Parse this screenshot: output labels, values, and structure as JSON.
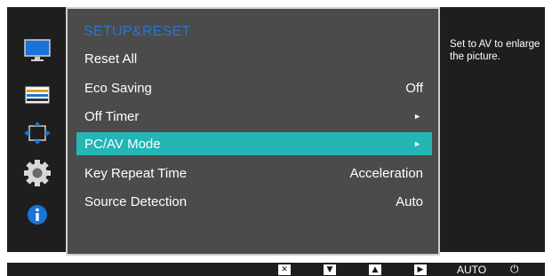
{
  "sidebar": {
    "icons": [
      "monitor-picture-icon",
      "color-bars-icon",
      "resize-arrows-icon",
      "gear-icon",
      "info-icon"
    ]
  },
  "menu": {
    "title": "SETUP&RESET",
    "items": [
      {
        "label": "Reset All",
        "value": "",
        "arrow": false
      },
      {
        "label": "Eco Saving",
        "value": "Off",
        "arrow": false
      },
      {
        "label": "Off Timer",
        "value": "",
        "arrow": true
      },
      {
        "label": "PC/AV Mode",
        "value": "",
        "arrow": true,
        "selected": true
      },
      {
        "label": "Key Repeat Time",
        "value": "Acceleration",
        "arrow": false
      },
      {
        "label": "Source Detection",
        "value": "Auto",
        "arrow": false
      }
    ],
    "arrow_glyph": "►"
  },
  "help": {
    "text": "Set to AV to enlarge the picture."
  },
  "bottom_bar": {
    "close_glyph": "✕",
    "down_glyph": "▼",
    "up_glyph": "▲",
    "enter_glyph": "▶",
    "auto_label": "AUTO",
    "power_glyph": "⏻"
  },
  "colors": {
    "background": "#1e1e1e",
    "menu_panel": "#4b4b4b",
    "selected": "#24b5b5",
    "title": "#2e74c9"
  }
}
